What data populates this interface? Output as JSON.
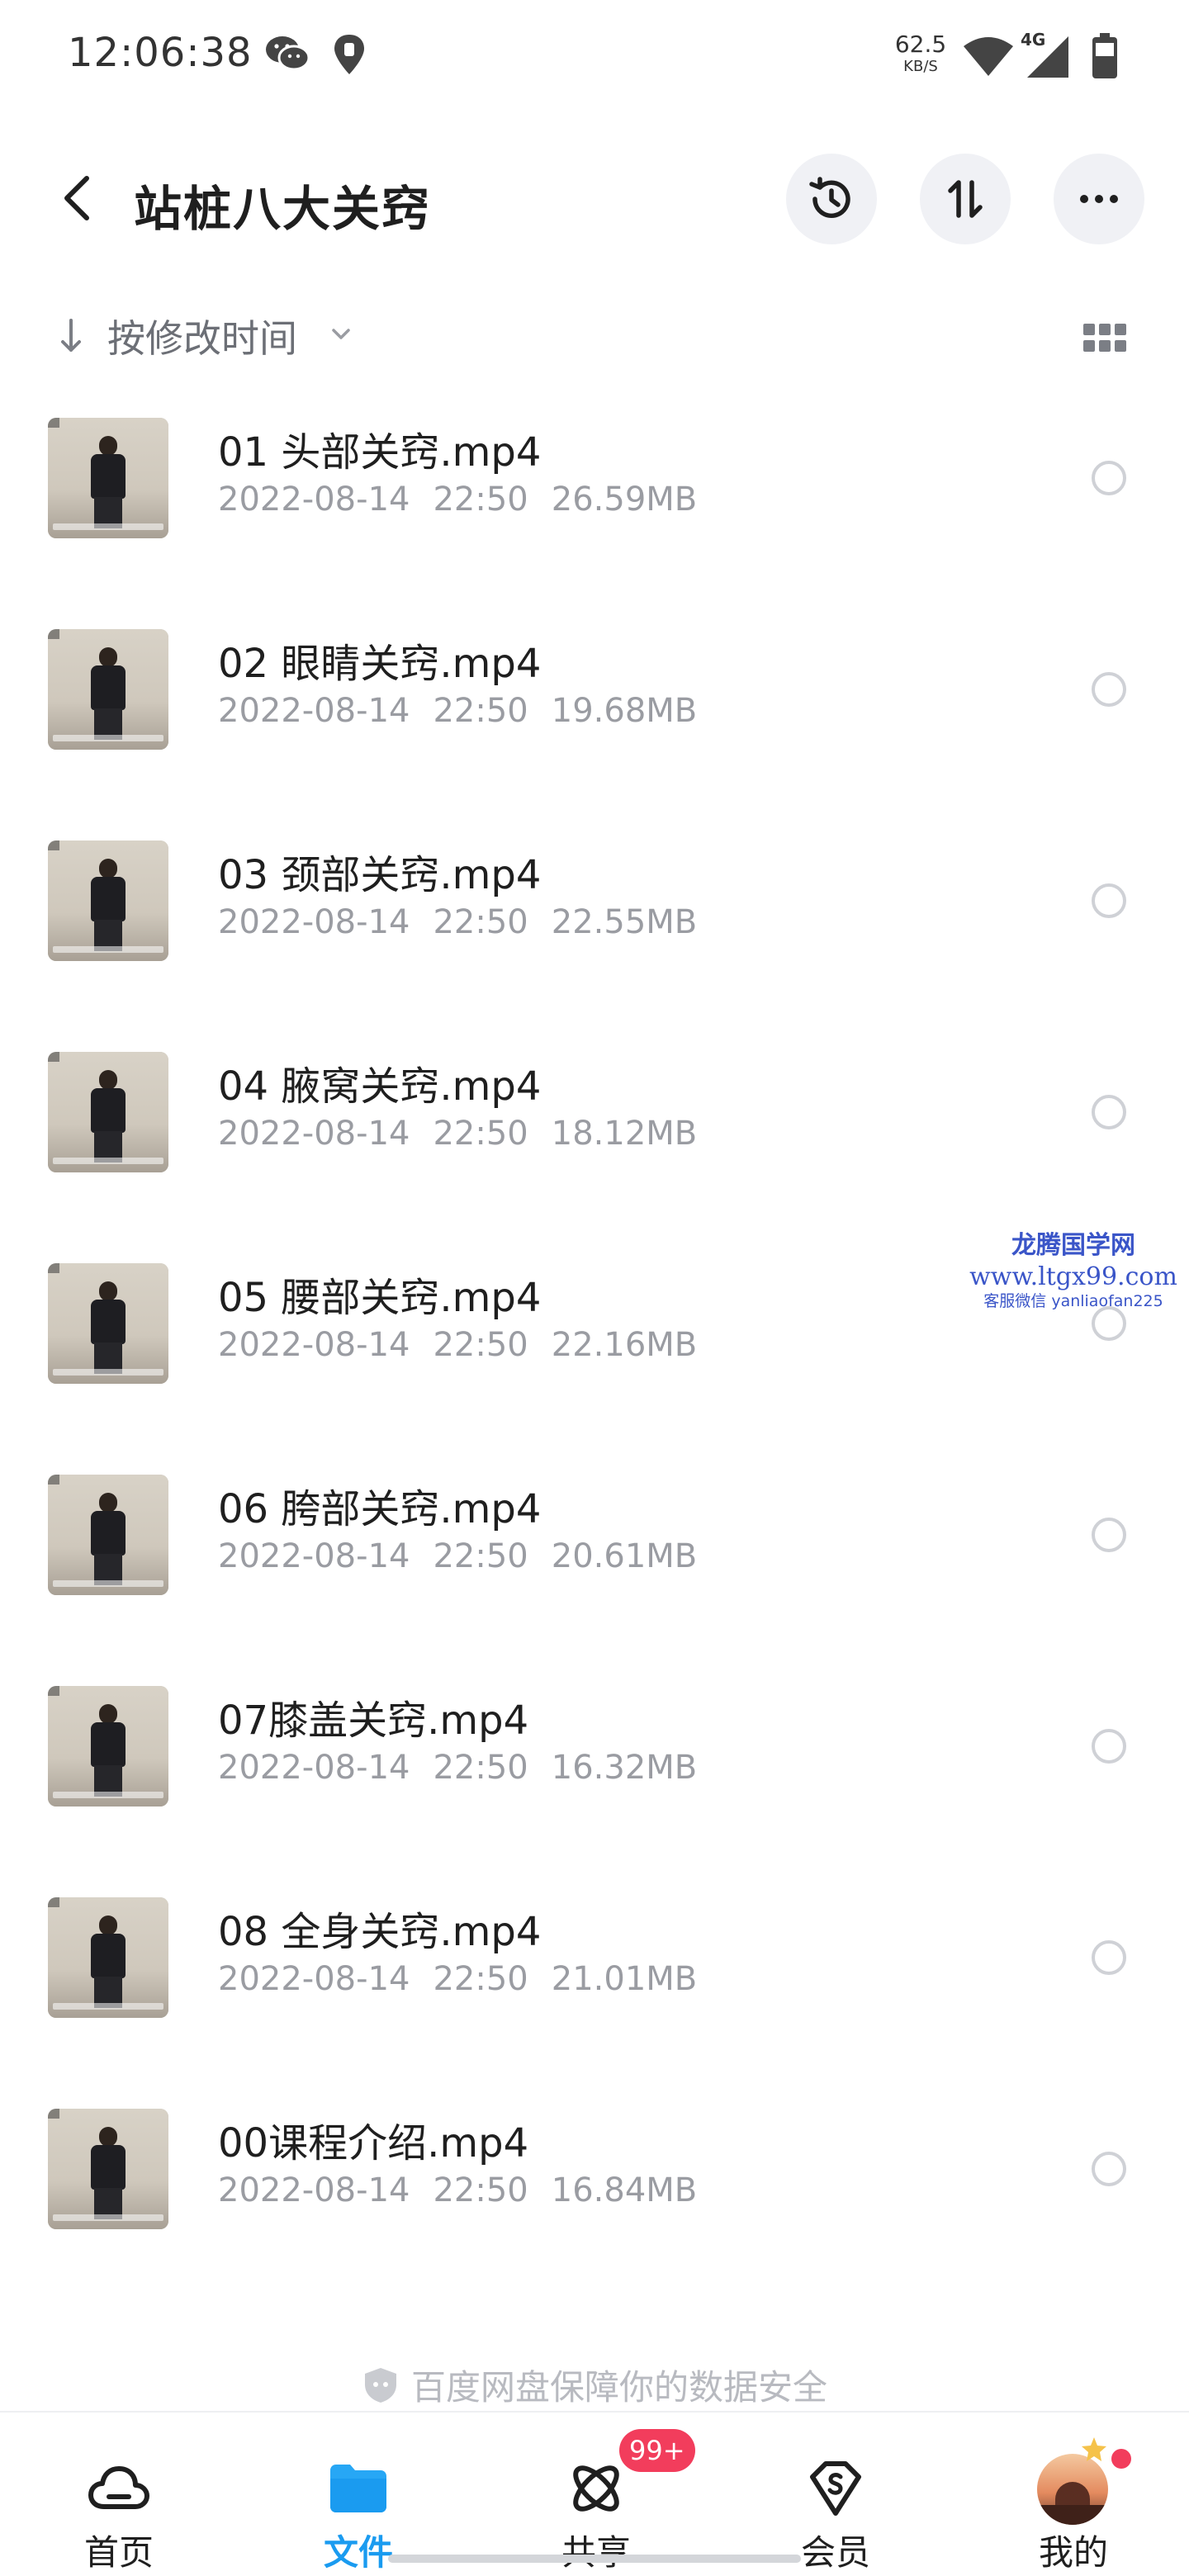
{
  "status_bar": {
    "time": "12:06:38",
    "net_speed_value": "62.5",
    "net_speed_unit": "KB/S",
    "network_type": "4G",
    "icons": [
      "wechat-icon",
      "location-icon",
      "wifi-icon",
      "cellular-signal-icon",
      "battery-icon"
    ]
  },
  "header": {
    "title": "站桩八大关窍",
    "back_icon": "back-arrow-icon",
    "actions": [
      "history-icon",
      "sort-swap-icon",
      "more-icon"
    ]
  },
  "sort": {
    "label": "按修改时间",
    "direction_icon": "arrow-down-icon",
    "view_toggle_icon": "grid-view-icon"
  },
  "files": [
    {
      "name": "01 头部关窍.mp4",
      "date": "2022-08-14",
      "time": "22:50",
      "size": "26.59MB"
    },
    {
      "name": "02 眼睛关窍.mp4",
      "date": "2022-08-14",
      "time": "22:50",
      "size": "19.68MB"
    },
    {
      "name": "03 颈部关窍.mp4",
      "date": "2022-08-14",
      "time": "22:50",
      "size": "22.55MB"
    },
    {
      "name": "04 腋窝关窍.mp4",
      "date": "2022-08-14",
      "time": "22:50",
      "size": "18.12MB"
    },
    {
      "name": "05 腰部关窍.mp4",
      "date": "2022-08-14",
      "time": "22:50",
      "size": "22.16MB"
    },
    {
      "name": "06 胯部关窍.mp4",
      "date": "2022-08-14",
      "time": "22:50",
      "size": "20.61MB"
    },
    {
      "name": "07膝盖关窍.mp4",
      "date": "2022-08-14",
      "time": "22:50",
      "size": "16.32MB"
    },
    {
      "name": "08 全身关窍.mp4",
      "date": "2022-08-14",
      "time": "22:50",
      "size": "21.01MB"
    },
    {
      "name": "00课程介绍.mp4",
      "date": "2022-08-14",
      "time": "22:50",
      "size": "16.84MB"
    }
  ],
  "watermark": {
    "line1": "龙腾国学网",
    "line2": "www.ltgx99.com",
    "line3": "客服微信 yanliaofan225"
  },
  "safe_note": "百度网盘保障你的数据安全",
  "tabs": [
    {
      "label": "首页",
      "icon": "cloud-home-icon",
      "active": false
    },
    {
      "label": "文件",
      "icon": "folder-icon",
      "active": true
    },
    {
      "label": "共享",
      "icon": "share-orbit-icon",
      "active": false,
      "badge": "99+"
    },
    {
      "label": "会员",
      "icon": "vip-shield-icon",
      "active": false
    },
    {
      "label": "我的",
      "icon": "avatar",
      "active": false
    }
  ],
  "colors": {
    "accent": "#1a9bf0",
    "badge": "#f23d5c",
    "meta_text": "#9a9ca2",
    "watermark": "#3a55c8"
  }
}
